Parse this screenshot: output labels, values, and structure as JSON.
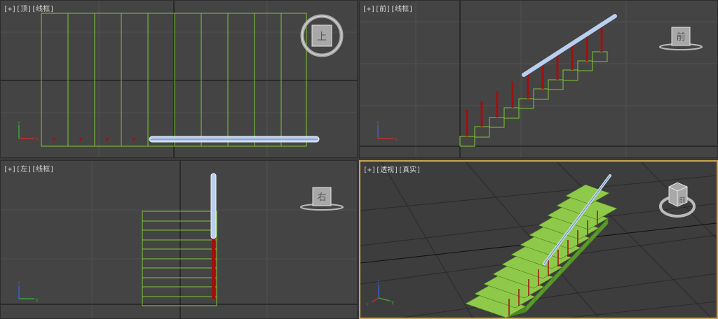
{
  "viewports": {
    "top": {
      "label": "[+][顶][线框]",
      "cube_face": "上"
    },
    "front": {
      "label": "[+][前][线框]",
      "cube_face": "前"
    },
    "left": {
      "label": "[+][左][线框]",
      "cube_face": "右"
    },
    "persp": {
      "label": "[+][透视][真实]",
      "cube_face": "前"
    }
  },
  "axes": {
    "x": "x",
    "y": "y",
    "z": "z"
  },
  "colors": {
    "accent_border": "#c8a64a",
    "stair_green": "#8fc94a",
    "wire_green": "#7ec832",
    "rail_blue": "#b8cff0",
    "baluster_red": "#a01010",
    "grid": "#505050",
    "axis": "#111111"
  },
  "icons": [
    "viewcube-icon",
    "axis-tripod-icon"
  ]
}
